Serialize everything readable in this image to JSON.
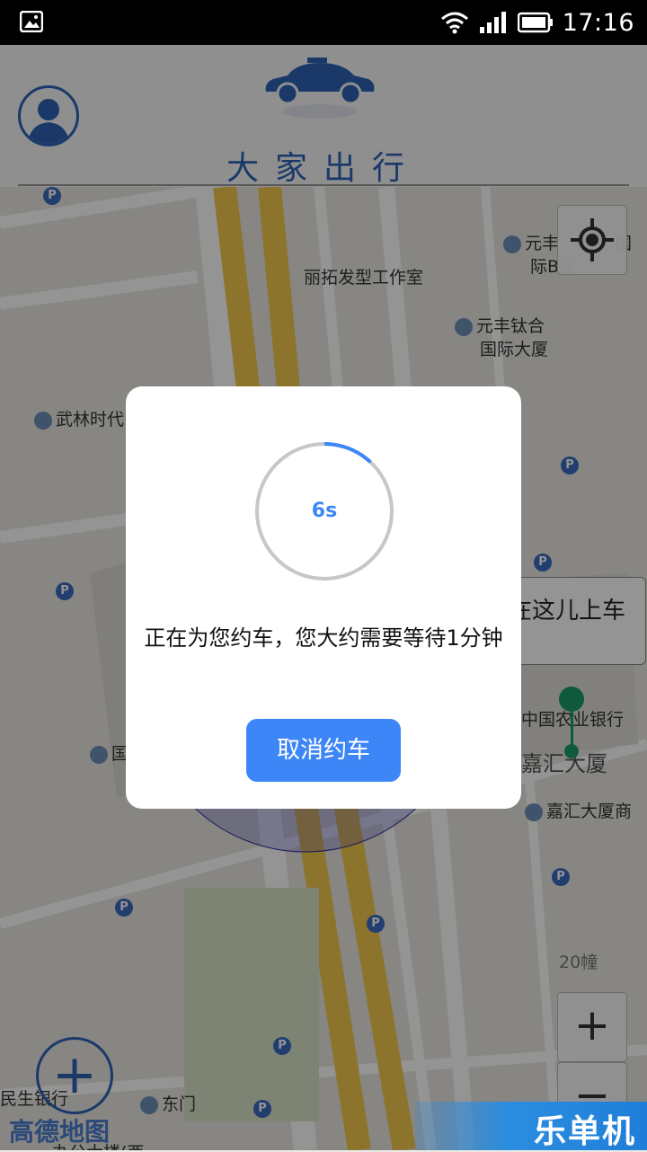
{
  "status_bar": {
    "time": "17:16"
  },
  "header": {
    "title": "大家出行"
  },
  "map": {
    "labels": {
      "salon": "丽拓发型工作室",
      "yuanfeng_top1": "元丰",
      "yuanfeng_top2": "际B座",
      "yuanfeng_top3": "国",
      "yuanfeng1": "元丰钛合",
      "yuanfeng2": "国际大厦",
      "wulin": "武林时代",
      "guo": "国",
      "bank": "中国农业银行",
      "jiahui": "嘉汇大厦",
      "jiahui_shop": "嘉汇大厦商",
      "building20": "20幢",
      "minsheng": "民生银行",
      "dongmen": "东门",
      "office": "办公大楼(西",
      "amap": "高德地图"
    },
    "callout_text": "在这儿上车",
    "zoom_in": "+",
    "zoom_out": "−",
    "add": "+"
  },
  "dialog": {
    "countdown": "6s",
    "progress": 0.12,
    "message": "正在为您约车，您大约需要等待1分钟",
    "cancel_label": "取消约车"
  },
  "watermark": "乐单机",
  "colors": {
    "brand_blue": "#2d63b5",
    "button_blue": "#3d86f7",
    "road_yellow": "#f2c94c",
    "pin_green": "#1a9a6b"
  }
}
